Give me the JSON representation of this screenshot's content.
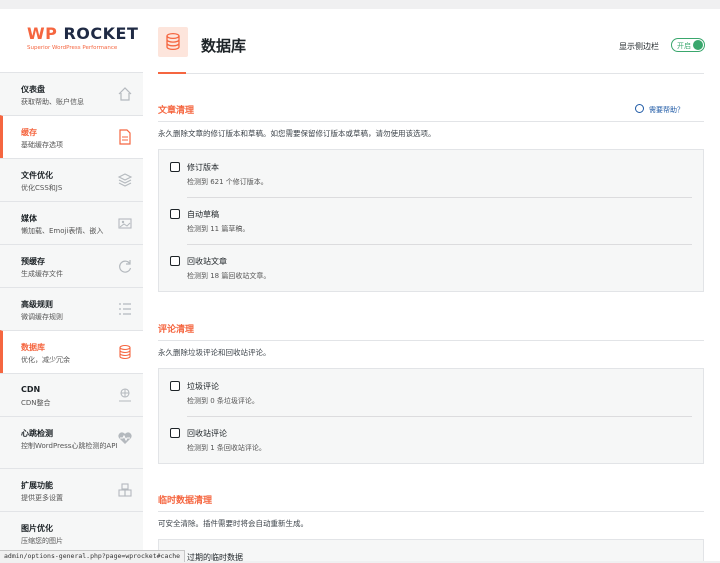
{
  "logo": {
    "brand_wp": "WP",
    "brand_rest": "ROCKET",
    "tagline": "Superior WordPress Performance"
  },
  "sidebar": {
    "items": [
      {
        "title": "仪表盘",
        "sub": "获取帮助、账户信息",
        "icon": "home-icon"
      },
      {
        "title": "缓存",
        "sub": "基础缓存选项",
        "icon": "page-icon"
      },
      {
        "title": "文件优化",
        "sub": "优化CSS和JS",
        "icon": "layers-icon"
      },
      {
        "title": "媒体",
        "sub": "懒加载、Emoji表情、嵌入",
        "icon": "image-icon"
      },
      {
        "title": "预缓存",
        "sub": "生成缓存文件",
        "icon": "refresh-icon"
      },
      {
        "title": "高级规则",
        "sub": "微调缓存规则",
        "icon": "list-icon"
      },
      {
        "title": "数据库",
        "sub": "优化，减少冗余",
        "icon": "database-icon"
      },
      {
        "title": "CDN",
        "sub": "CDN整合",
        "icon": "cdn-icon"
      },
      {
        "title": "心跳检测",
        "sub": "控制WordPress心跳检测的API",
        "icon": "heartbeat-icon"
      },
      {
        "title": "扩展功能",
        "sub": "提供更多设置",
        "icon": "addons-icon"
      },
      {
        "title": "图片优化",
        "sub": "压缩您的图片",
        "icon": "compress-icon"
      }
    ]
  },
  "header": {
    "title": "数据库",
    "toggle_label": "显示侧边栏",
    "toggle_state": "开启"
  },
  "sections": {
    "posts": {
      "title": "文章清理",
      "help": "需要帮助？",
      "desc": "永久删除文章的修订版本和草稿。如您需要保留修订版本或草稿，请勿使用该选项。",
      "options": [
        {
          "label": "修订版本",
          "desc": "检测到 621 个修订版本。"
        },
        {
          "label": "自动草稿",
          "desc": "检测到 11 篇草稿。"
        },
        {
          "label": "回收站文章",
          "desc": "检测到 18 篇回收站文章。"
        }
      ]
    },
    "comments": {
      "title": "评论清理",
      "desc": "永久删除垃圾评论和回收站评论。",
      "options": [
        {
          "label": "垃圾评论",
          "desc": "检测到 0 条垃圾评论。"
        },
        {
          "label": "回收站评论",
          "desc": "检测到 1 条回收站评论。"
        }
      ]
    },
    "transients": {
      "title": "临时数据清理",
      "desc": "可安全清除。插件需要时将会自动重新生成。",
      "options": [
        {
          "label": "过期的临时数据"
        }
      ]
    }
  },
  "statusbar": {
    "url": "admin/options-general.php?page=wprocket#cache"
  },
  "colors": {
    "accent": "#f56640",
    "toggle": "#3aa76d",
    "link": "#1f5aa6"
  }
}
